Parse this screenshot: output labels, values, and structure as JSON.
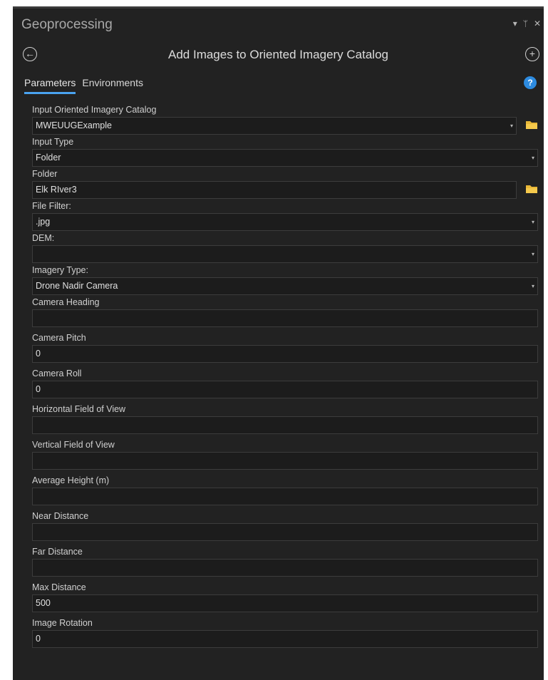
{
  "pane": {
    "title": "Geoprocessing",
    "controls": {
      "menu": "▾",
      "pin": "ᛘ",
      "close": "✕"
    }
  },
  "toolbar": {
    "back_icon": "←",
    "title": "Add Images to Oriented Imagery Catalog",
    "add_icon": "+"
  },
  "tabs": [
    {
      "label": "Parameters",
      "active": true
    },
    {
      "label": "Environments",
      "active": false
    }
  ],
  "help_icon": "?",
  "params": [
    {
      "label": "Input Oriented Imagery Catalog",
      "value": "MWEUUGExample",
      "dropdown": true,
      "browse": true
    },
    {
      "label": "Input Type",
      "value": "Folder",
      "dropdown": true,
      "browse": false
    },
    {
      "label": "Folder",
      "value": "Elk RIver3",
      "dropdown": false,
      "browse": true
    },
    {
      "label": "File Filter:",
      "value": ".jpg",
      "dropdown": true,
      "browse": false
    },
    {
      "label": "DEM:",
      "value": "",
      "dropdown": true,
      "browse": false
    },
    {
      "label": "Imagery Type:",
      "value": "Drone Nadir Camera",
      "dropdown": true,
      "browse": false
    },
    {
      "label": "Camera Heading",
      "value": "",
      "dropdown": false,
      "browse": false
    },
    {
      "label": "Camera Pitch",
      "value": "0",
      "dropdown": false,
      "browse": false
    },
    {
      "label": "Camera Roll",
      "value": "0",
      "dropdown": false,
      "browse": false
    },
    {
      "label": "Horizontal Field of View",
      "value": "",
      "dropdown": false,
      "browse": false
    },
    {
      "label": "Vertical Field of View",
      "value": "",
      "dropdown": false,
      "browse": false
    },
    {
      "label": "Average Height (m)",
      "value": "",
      "dropdown": false,
      "browse": false
    },
    {
      "label": "Near Distance",
      "value": "",
      "dropdown": false,
      "browse": false
    },
    {
      "label": "Far Distance",
      "value": "",
      "dropdown": false,
      "browse": false
    },
    {
      "label": "Max Distance",
      "value": "500",
      "dropdown": false,
      "browse": false
    },
    {
      "label": "Image Rotation",
      "value": "0",
      "dropdown": false,
      "browse": false
    }
  ],
  "colors": {
    "accent": "#4aa3f0",
    "folder": "#e8b737",
    "background": "#222222"
  }
}
